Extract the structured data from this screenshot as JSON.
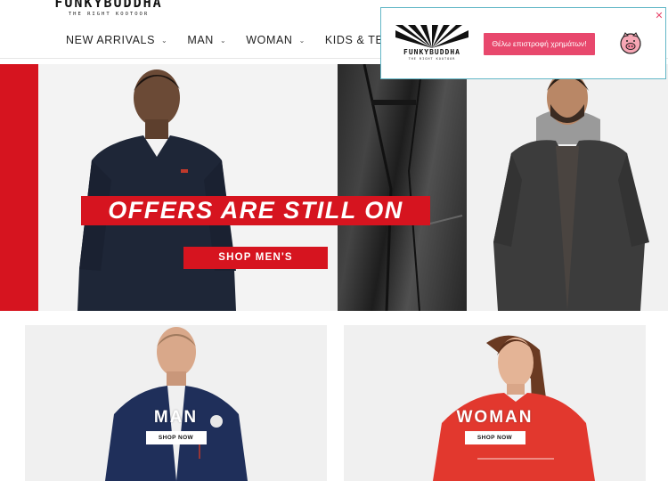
{
  "header": {
    "logo_main": "FUNKYBUDDHA",
    "logo_tagline": "THE RIGHT KOOTOOR"
  },
  "nav": {
    "items": [
      {
        "label": "NEW ARRIVALS",
        "has_dropdown": true
      },
      {
        "label": "MAN",
        "has_dropdown": true
      },
      {
        "label": "WOMAN",
        "has_dropdown": true
      },
      {
        "label": "KIDS & TEENS",
        "has_dropdown": false
      }
    ],
    "dropdown_icon": "chevron-down-icon"
  },
  "hero": {
    "headline": "OFFERS ARE STILL ON",
    "cta": "SHOP MEN'S"
  },
  "tiles": {
    "man": {
      "title": "MAN",
      "cta": "SHOP NOW"
    },
    "woman": {
      "title": "WOMAN",
      "cta": "SHOP NOW"
    }
  },
  "popup": {
    "logo_main": "FUNKYBUDDHA",
    "logo_tagline": "THE RIGHT KOOTOOR",
    "cta": "Θέλω επιστροφή χρημάτων!",
    "icon": "piggy-bank-icon",
    "close_icon": "close-icon"
  },
  "colors": {
    "brand_red": "#d6141f",
    "popup_pink": "#e8486d",
    "popup_border": "#63b7c7"
  }
}
